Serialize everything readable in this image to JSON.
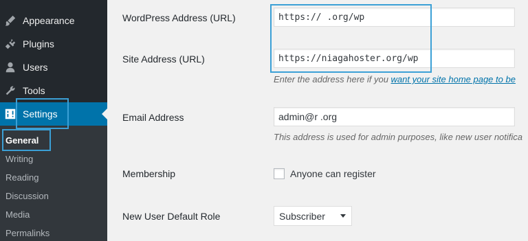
{
  "sidebar": {
    "items": [
      {
        "label": "Appearance",
        "icon": "paintbrush-icon"
      },
      {
        "label": "Plugins",
        "icon": "plugin-icon"
      },
      {
        "label": "Users",
        "icon": "user-icon"
      },
      {
        "label": "Tools",
        "icon": "wrench-icon"
      },
      {
        "label": "Settings",
        "icon": "settings-sliders-icon"
      }
    ],
    "submenu": [
      "General",
      "Writing",
      "Reading",
      "Discussion",
      "Media",
      "Permalinks"
    ]
  },
  "form": {
    "wp_address_label": "WordPress Address (URL)",
    "wp_address_value": "https://            .org/wp",
    "site_address_label": "Site Address (URL)",
    "site_address_value": "https://niagahoster.org/wp",
    "site_address_desc": "Enter the address here if you ",
    "site_address_link": "want your site home page to be",
    "email_label": "Email Address",
    "email_value": "admin@r              .org",
    "email_desc": "This address is used for admin purposes, like new user notifica",
    "membership_label": "Membership",
    "membership_checkbox_label": "Anyone can register",
    "default_role_label": "New User Default Role",
    "default_role_value": "Subscriber"
  },
  "colors": {
    "sidebar_bg": "#23282d",
    "submenu_bg": "#32373c",
    "active_bg": "#0073aa",
    "highlight_border": "#3ba0d6"
  }
}
